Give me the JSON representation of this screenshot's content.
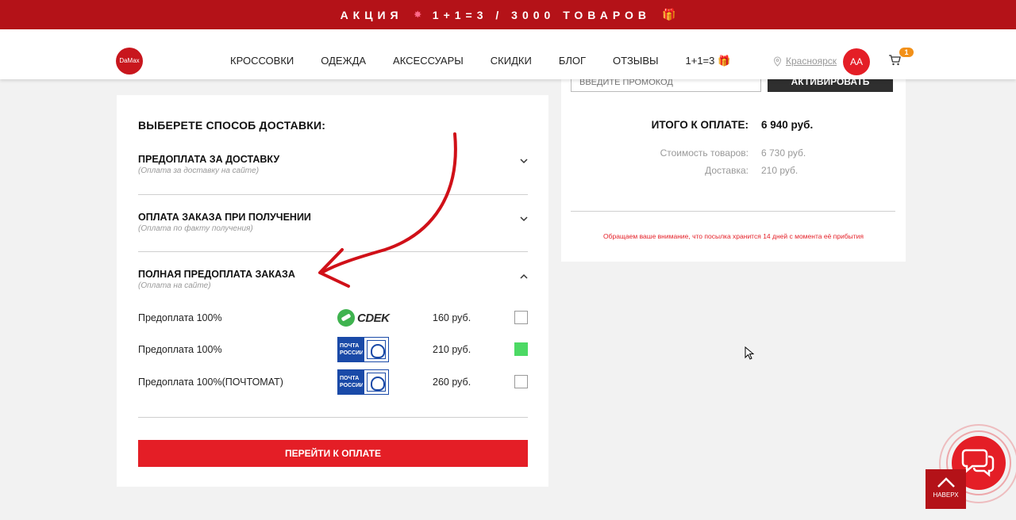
{
  "promo_bar": {
    "part1": "АКЦИЯ",
    "part2": "1+1=3 / 3000 ТОВАРОВ",
    "star_icon": "star-icon",
    "gift_icon": "gift-icon"
  },
  "header": {
    "logo_text": "DaMax",
    "nav": [
      {
        "label": "КРОССОВКИ"
      },
      {
        "label": "ОДЕЖДА"
      },
      {
        "label": "АКСЕССУАРЫ"
      },
      {
        "label": "СКИДКИ"
      },
      {
        "label": "БЛОГ"
      },
      {
        "label": "ОТЗЫВЫ"
      },
      {
        "label": "1+1=3"
      }
    ],
    "city": "Красноярск",
    "avatar": "AA",
    "cart_count": "1"
  },
  "delivery": {
    "title": "ВЫБЕРЕТЕ СПОСОБ ДОСТАВКИ:",
    "sections": [
      {
        "title": "ПРЕДОПЛАТА ЗА ДОСТАВКУ",
        "subtitle": "(Оплата за доставку на сайте)",
        "expanded": false
      },
      {
        "title": "ОПЛАТА ЗАКАЗА ПРИ ПОЛУЧЕНИИ",
        "subtitle": "(Оплата по факту получения)",
        "expanded": false
      },
      {
        "title": "ПОЛНАЯ ПРЕДОПЛАТА ЗАКАЗА",
        "subtitle": "(Оплата на сайте)",
        "expanded": true
      }
    ],
    "options": [
      {
        "name": "Предоплата 100%",
        "carrier": "СДЕК",
        "price": "160 руб.",
        "selected": false
      },
      {
        "name": "Предоплата 100%",
        "carrier": "ПОЧТА РОССИИ",
        "price": "210 руб.",
        "selected": true
      },
      {
        "name": "Предоплата 100%(ПОЧТОМАТ)",
        "carrier": "ПОЧТА РОССИИ",
        "price": "260 руб.",
        "selected": false
      }
    ],
    "pochta_line1": "ПОЧТА",
    "pochta_line2": "РОССИИ",
    "cdek_word": "CDEK",
    "pay_button": "ПЕРЕЙТИ К ОПЛАТЕ"
  },
  "summary": {
    "promo_placeholder": "ВВЕДИТЕ ПРОМОКОД",
    "promo_button": "АКТИВИРОВАТЬ",
    "total_label": "ИТОГО К ОПЛАТЕ:",
    "total_value": "6 940 руб.",
    "goods_label": "Стоимость товаров:",
    "goods_value": "6 730 руб.",
    "delivery_label": "Доставка:",
    "delivery_value": "210 руб.",
    "notice": "Обращаем ваше внимание, что посылка хранится 14 дней с момента её прибытия"
  },
  "widgets": {
    "to_top": "НАВЕРХ"
  },
  "colors": {
    "brand_red": "#e41e26",
    "dark_red": "#b41218",
    "selected_green": "#4cd964",
    "badge_orange": "#f29018"
  }
}
